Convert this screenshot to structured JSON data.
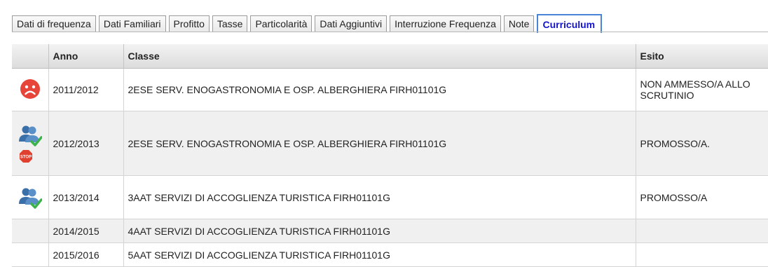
{
  "tabs": [
    {
      "label": "Dati di frequenza",
      "active": false
    },
    {
      "label": "Dati Familiari",
      "active": false
    },
    {
      "label": "Profitto",
      "active": false
    },
    {
      "label": "Tasse",
      "active": false
    },
    {
      "label": "Particolarità",
      "active": false
    },
    {
      "label": "Dati Aggiuntivi",
      "active": false
    },
    {
      "label": "Interruzione Frequenza",
      "active": false
    },
    {
      "label": "Note",
      "active": false
    },
    {
      "label": "Curriculum",
      "active": true
    }
  ],
  "table": {
    "headers": {
      "icon": "",
      "anno": "Anno",
      "classe": "Classe",
      "esito": "Esito"
    },
    "rows": [
      {
        "icons": [
          "sad-face-icon"
        ],
        "anno": "2011/2012",
        "classe": "2ESE SERV. ENOGASTRONOMIA E OSP. ALBERGHIERA FIRH01101G",
        "esito": "NON AMMESSO/A ALLO SCRUTINIO"
      },
      {
        "icons": [
          "promoted-users-icon",
          "stop-sign-icon"
        ],
        "stop_label": "STOP",
        "anno": "2012/2013",
        "classe": "2ESE SERV. ENOGASTRONOMIA E OSP. ALBERGHIERA FIRH01101G",
        "esito": "PROMOSSO/A."
      },
      {
        "icons": [
          "promoted-users-icon"
        ],
        "anno": "2013/2014",
        "classe": "3AAT SERVIZI DI ACCOGLIENZA TURISTICA FIRH01101G",
        "esito": "PROMOSSO/A"
      },
      {
        "icons": [],
        "anno": "2014/2015",
        "classe": "4AAT SERVIZI DI ACCOGLIENZA TURISTICA FIRH01101G",
        "esito": ""
      },
      {
        "icons": [],
        "anno": "2015/2016",
        "classe": "5AAT SERVIZI DI ACCOGLIENZA TURISTICA FIRH01101G",
        "esito": ""
      }
    ]
  },
  "colors": {
    "active_tab_text": "#1515cc",
    "active_tab_border": "#4a84d8",
    "sad_face": "#e8453a",
    "users_icon": "#3a6fa8",
    "check_mark": "#3bb34a",
    "stop_sign": "#e0402e"
  }
}
